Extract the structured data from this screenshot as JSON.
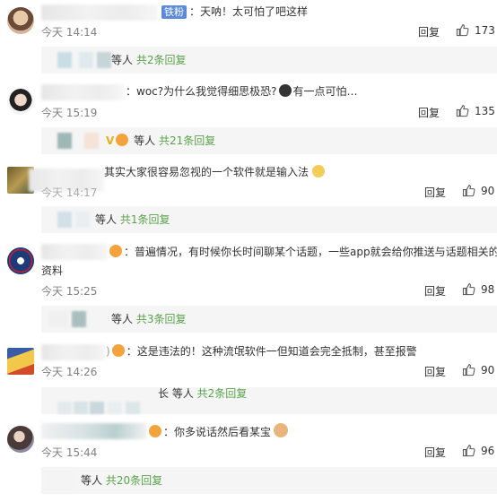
{
  "comments": [
    {
      "badge": "铁粉",
      "text": "：天呐！太可怕了吧这样",
      "time": "今天 14:14",
      "reply_label": "回复",
      "likes": "173",
      "sub": {
        "prefix": "等人",
        "link": "共2条回复"
      }
    },
    {
      "text": "：woc?为什么我觉得细思极恐?",
      "text2": "有一点可怕…",
      "time": "今天 15:19",
      "reply_label": "回复",
      "likes": "135",
      "sub": {
        "prefix": "等人",
        "link": "共21条回复"
      }
    },
    {
      "text": "其实大家很容易忽视的一个软件就是输入法",
      "time": "今天 14:17",
      "reply_label": "回复",
      "likes": "90",
      "sub": {
        "prefix": "等人",
        "link": "共1条回复"
      }
    },
    {
      "text": "：普遍情况，有时候你长时间聊某个话题，一些app就会给你推送与话题相关的",
      "text_cont": "资料",
      "time": "今天 15:25",
      "reply_label": "回复",
      "likes": "98",
      "sub": {
        "prefix": "等人",
        "link": "共3条回复"
      }
    },
    {
      "text": "：这是违法的！这种流氓软件一但知道会完全抵制，甚至报警",
      "time": "今天 14:26",
      "reply_label": "回复",
      "likes": "90",
      "sub": {
        "prefix": "长 等人",
        "link": "共2条回复"
      }
    },
    {
      "text": "：你多说话然后看某宝",
      "time": "今天 15:44",
      "reply_label": "回复",
      "likes": "96",
      "sub": {
        "prefix": "等人",
        "link": "共20条回复"
      }
    }
  ],
  "colors": {
    "link": "#5aa34a",
    "badge": "#5b8ad8",
    "time": "#808080",
    "sub_bg": "#f5f5f5"
  },
  "icons": {
    "like": "thumbs-up-icon"
  }
}
